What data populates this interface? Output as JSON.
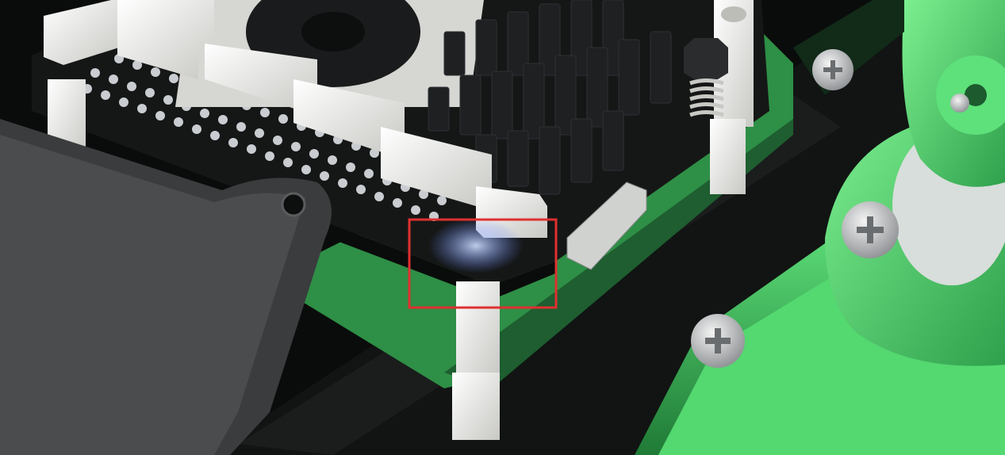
{
  "scene": {
    "subject": "hat-board-with-heatsink-and-green-robot-parts",
    "colors": {
      "background": "#0a0c0b",
      "board_black": "#141615",
      "board_green": "#3fbf60",
      "part_green": "#5ee07a",
      "connector_white": "#e8e8e6",
      "pin_pad": "#c9ccd0",
      "standoff": "#e6e6e2",
      "heatsink": "#1b1d1f",
      "highlight_box": "#e03030"
    },
    "highlight": {
      "shape": "rectangle",
      "color": "#e03030",
      "marks": "board-corner-near-connectors"
    },
    "icons": [
      "screw-icon",
      "spring-icon",
      "fan-icon"
    ]
  }
}
